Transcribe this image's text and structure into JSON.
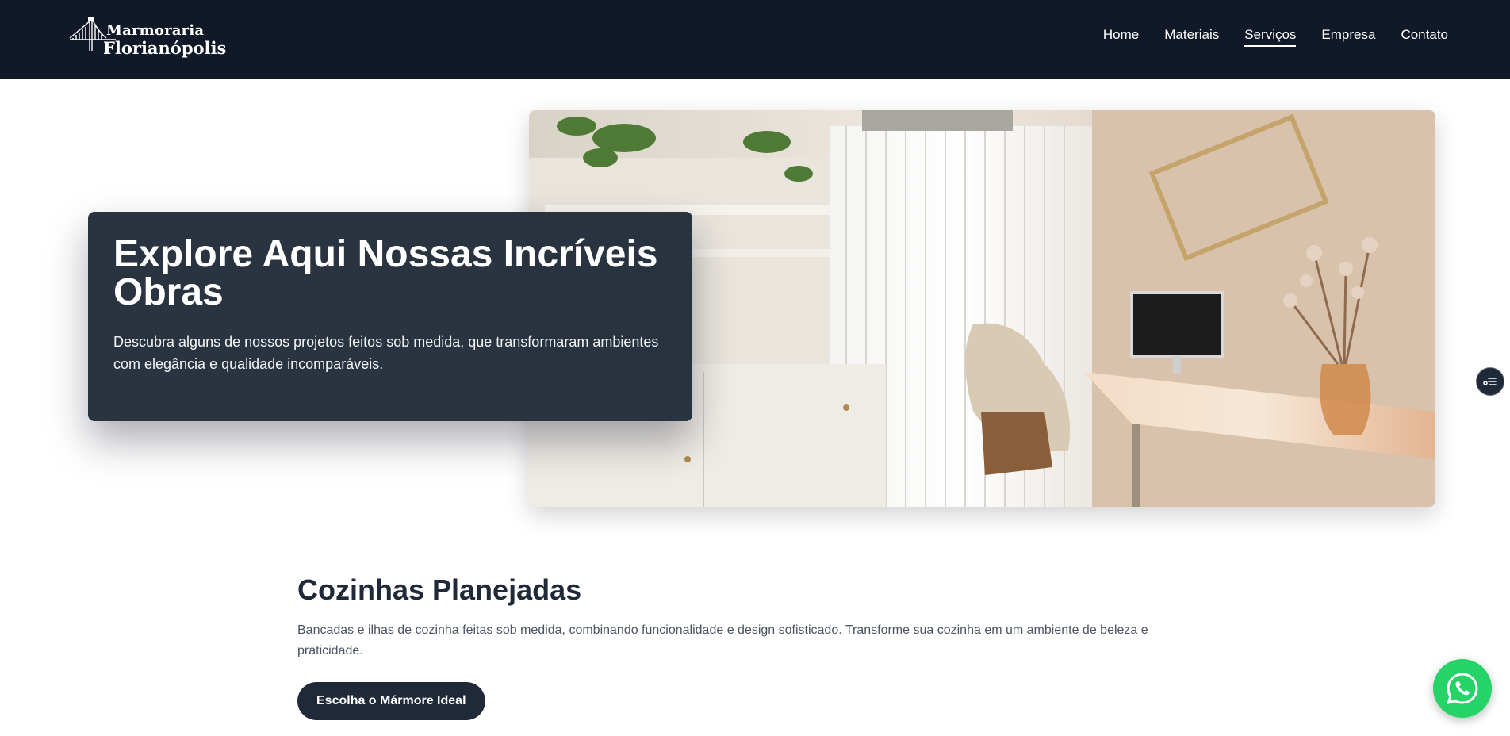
{
  "header": {
    "logo": {
      "line1": "Marmoraria",
      "line2": "Florianópolis"
    },
    "nav": [
      {
        "label": "Home",
        "active": false
      },
      {
        "label": "Materiais",
        "active": false
      },
      {
        "label": "Serviços",
        "active": true
      },
      {
        "label": "Empresa",
        "active": false
      },
      {
        "label": "Contato",
        "active": false
      }
    ]
  },
  "hero": {
    "title": "Explore Aqui Nossas Incríveis Obras",
    "description": "Descubra alguns de nossos projetos feitos sob medida, que transformaram ambientes com elegância e qualidade incomparáveis.",
    "image": "interior-office-with-onyx-desk"
  },
  "section": {
    "title": "Cozinhas Planejadas",
    "description": "Bancadas e ilhas de cozinha feitas sob medida, combinando funcionalidade e design sofisticado. Transforme sua cozinha em um ambiente de beleza e praticidade.",
    "cta_label": "Escolha o Mármore Ideal"
  },
  "floating": {
    "side_icon": "menu-list-icon",
    "whatsapp_icon": "whatsapp-icon"
  },
  "colors": {
    "header_bg": "#111827",
    "card_bg": "#1f2937",
    "text_dark": "#1f2937",
    "text_muted": "#4b5563",
    "whatsapp": "#25d366"
  }
}
